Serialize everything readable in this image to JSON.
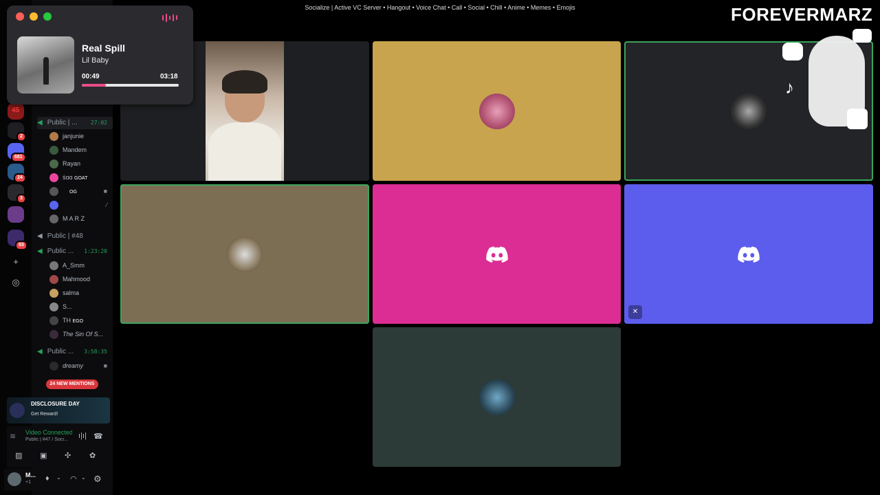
{
  "window": {
    "title": "Socialize | Active VC Server • Hangout • Voice Chat • Call • Social • Chill • Anime • Memes • Emojis"
  },
  "brand": {
    "text": "FOREVERMARZ"
  },
  "player": {
    "title": "Real Spill",
    "artist": "Lil Baby",
    "current_time": "00:49",
    "total_time": "03:18",
    "progress_fraction": 0.247
  },
  "server_rail": {
    "badges": [
      "45",
      "2",
      "681",
      "24",
      "3",
      "93"
    ]
  },
  "channels": {
    "ch1": {
      "label": "Public | ...",
      "timer": "27:02"
    },
    "ch1_members": [
      {
        "name": "janjunie",
        "extra": ""
      },
      {
        "name": "Mandem",
        "extra": ""
      },
      {
        "name": "Rayan",
        "extra": ""
      },
      {
        "name": "ṡɑɑ",
        "extra": "GOAT"
      },
      {
        "name": "",
        "extra": "OG"
      },
      {
        "name": "",
        "extra": ""
      },
      {
        "name": "M A R Z",
        "extra": ""
      }
    ],
    "ch2": {
      "label": "Public | #48"
    },
    "ch3": {
      "label": "Public ...",
      "timer": "1:23:20"
    },
    "ch3_members": [
      {
        "name": "A_Smm",
        "extra": ""
      },
      {
        "name": "Mahmood",
        "extra": ""
      },
      {
        "name": "salma",
        "extra": ""
      },
      {
        "name": "S...",
        "extra": ""
      },
      {
        "name": "TH",
        "extra": "EGO"
      },
      {
        "name": "The Sin Of S...",
        "extra": ""
      }
    ],
    "ch4": {
      "label": "Public ...",
      "timer": "3:58:35"
    },
    "ch4_members": [
      {
        "name": "dreamy",
        "extra": ""
      }
    ]
  },
  "mentions": {
    "label": "24 NEW MENTIONS"
  },
  "promo": {
    "title": "DISCLOSURE DAY",
    "subtitle": "Get Reward!"
  },
  "voice": {
    "status": "Video Connected",
    "channel": "Public | #47 / Soci..."
  },
  "user": {
    "name": "M...",
    "status": "+1"
  },
  "tiles": {
    "colors": {
      "t1": "#1e1f22",
      "t2": "#c8a44e",
      "t3": "#232428",
      "t4": "#7b6e52",
      "t5": "#dc2d95",
      "t6": "#5c5ded",
      "t7": "#2d3b38"
    }
  }
}
